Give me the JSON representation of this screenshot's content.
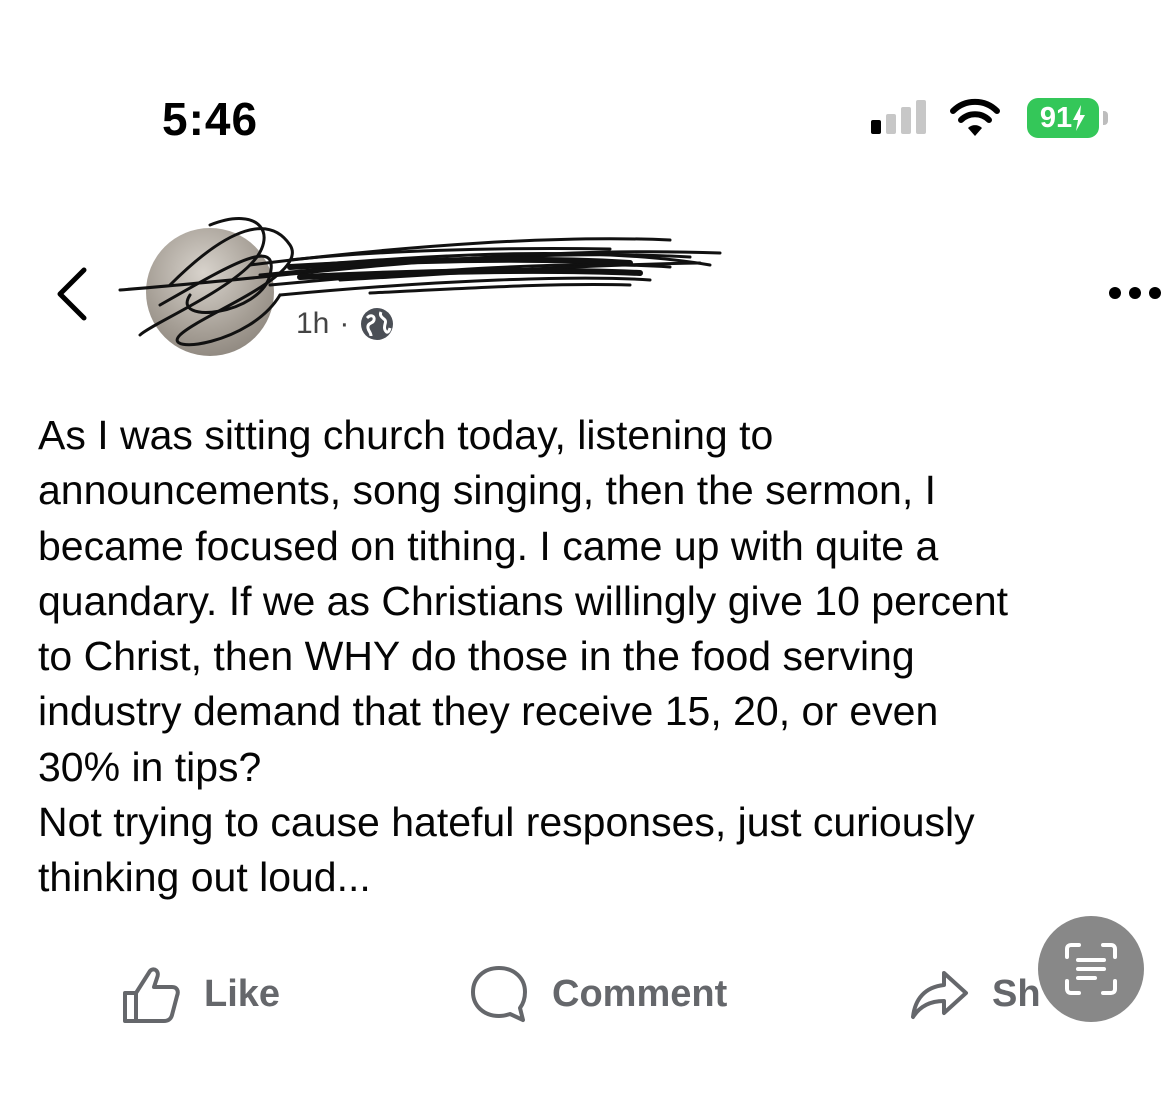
{
  "status_bar": {
    "time": "5:46",
    "battery": "91"
  },
  "post": {
    "timestamp": "1h",
    "separator": "·",
    "text": "As I was sitting church today, listening to\nannouncements, song singing, then the sermon, I\nbecame focused on tithing. I came up with quite a\nquandary. If we as Christians willingly give 10 percent\nto Christ, then WHY do those in the food serving\nindustry demand that they receive 15, 20, or even\n30% in tips?\nNot trying to cause hateful responses, just curiously\nthinking out loud..."
  },
  "actions": {
    "like_label": "Like",
    "comment_label": "Comment",
    "share_label": "Sh"
  },
  "icons": {
    "back": "chevron-left-icon",
    "privacy": "globe-icon",
    "more": "more-horizontal-icon",
    "like": "thumbs-up-icon",
    "comment": "comment-bubble-icon",
    "share": "share-arrow-icon",
    "live_text": "live-text-scan-icon"
  },
  "colors": {
    "battery": "#34c759",
    "action_text": "#65676b",
    "post_text": "#050505"
  }
}
